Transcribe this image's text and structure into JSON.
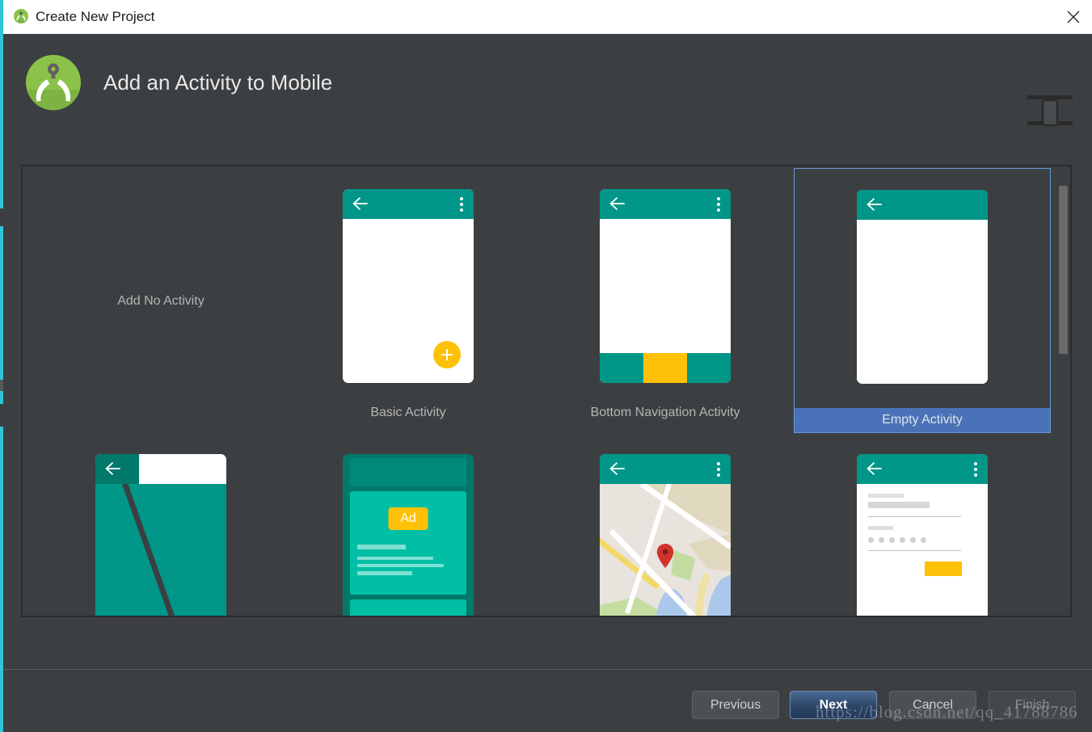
{
  "window": {
    "title": "Create New Project",
    "close_label": "✕",
    "app_icon": "android-studio-icon"
  },
  "header": {
    "title": "Add an Activity to Mobile",
    "logo_icon": "android-studio-logo",
    "device_icon": "mobile-device-icon"
  },
  "templates": [
    {
      "id": "add-no-activity",
      "label": "Add No Activity",
      "kind": "none",
      "selected": false
    },
    {
      "id": "basic-activity",
      "label": "Basic Activity",
      "kind": "basic",
      "selected": false
    },
    {
      "id": "bottom-navigation-activity",
      "label": "Bottom Navigation Activity",
      "kind": "bottomnav",
      "selected": false
    },
    {
      "id": "empty-activity",
      "label": "Empty Activity",
      "kind": "empty",
      "selected": true
    },
    {
      "id": "fullscreen-activity",
      "label": "",
      "kind": "fullscreen",
      "selected": false
    },
    {
      "id": "ad-activity",
      "label": "",
      "kind": "ad",
      "badge": "Ad",
      "selected": false
    },
    {
      "id": "google-maps-activity",
      "label": "",
      "kind": "map",
      "selected": false
    },
    {
      "id": "login-activity",
      "label": "",
      "kind": "login",
      "selected": false
    }
  ],
  "buttons": {
    "previous": "Previous",
    "next": "Next",
    "cancel": "Cancel",
    "finish": "Finish"
  },
  "watermark": "https://blog.csdn.net/qq_41788786",
  "colors": {
    "window_bg": "#3c3f41",
    "titlebar_bg": "#ffffff",
    "panel_border": "#2b2b2b",
    "teal": "#009688",
    "amber": "#FFC107",
    "selection_blue": "#4a72b8",
    "selection_border": "#6897d6",
    "text_muted": "#b5b5b5",
    "edge_accent": "#2ec6d6"
  }
}
